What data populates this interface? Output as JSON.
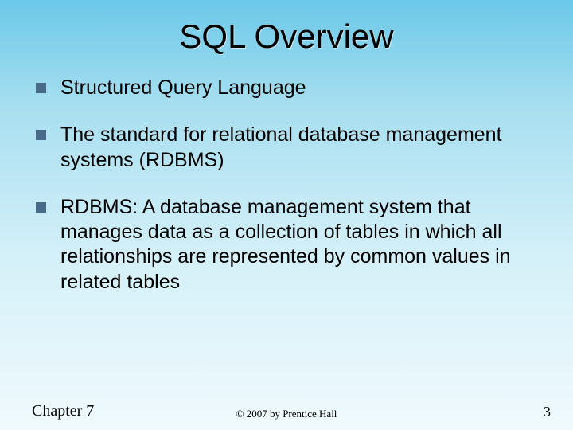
{
  "title": "SQL Overview",
  "bullets": [
    "Structured Query Language",
    "The standard for relational database management systems (RDBMS)",
    "RDBMS: A database management system that manages data as a collection of tables in which all relationships are represented by common values in related tables"
  ],
  "footer": {
    "left": "Chapter 7",
    "center": "© 2007 by Prentice Hall",
    "right": "3"
  }
}
